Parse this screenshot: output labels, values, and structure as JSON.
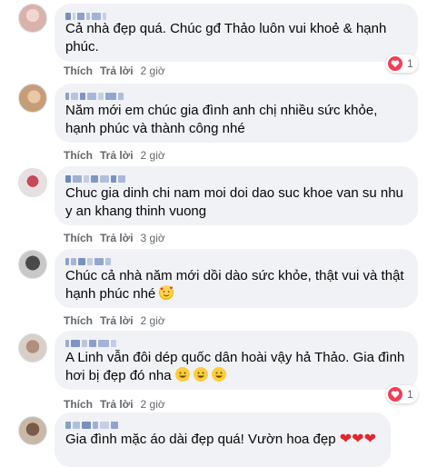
{
  "comments": [
    {
      "text": "Cả nhà đẹp quá. Chúc gđ Thảo luôn vui khoẻ & hạnh phúc.",
      "like_label": "Thích",
      "reply_label": "Trả lời",
      "time": "2 giờ",
      "reaction_count": "1"
    },
    {
      "text": "Năm mới em chúc gia đình anh chị nhiều sức khỏe, hạnh phúc và thành công nhé",
      "like_label": "Thích",
      "reply_label": "Trả lời",
      "time": "2 giờ"
    },
    {
      "text": "Chuc gia dinh chi nam moi doi dao suc khoe van su nhu y an khang thinh vuong",
      "like_label": "Thích",
      "reply_label": "Trả lời",
      "time": "3 giờ"
    },
    {
      "text": "Chúc cả nhà năm mới dồi dào sức khỏe, thật vui và thật hạnh phúc nhé",
      "like_label": "Thích",
      "reply_label": "Trả lời",
      "time": "2 giờ"
    },
    {
      "text": "A Linh vẫn đôi dép quốc dân hoài vậy hả Thảo. Gia đình hơi bị đẹp đó nha",
      "like_label": "Thích",
      "reply_label": "Trả lời",
      "time": "2 giờ",
      "reaction_count": "1"
    },
    {
      "text": "Gia đình mặc áo dài đẹp quá! Vườn hoa đẹp"
    }
  ],
  "colors": {
    "bubble": "#f0f2f5",
    "meta": "#65676b",
    "heart": "#f33e58",
    "text": "#050505"
  }
}
